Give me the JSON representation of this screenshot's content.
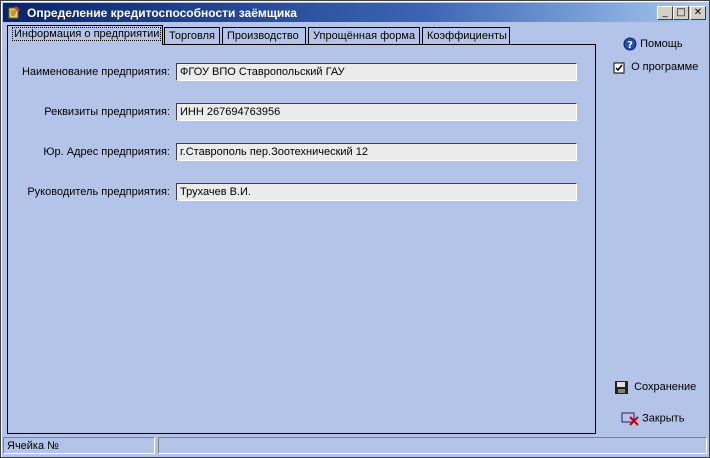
{
  "window": {
    "title": "Определение кредитоспособности заёмщика"
  },
  "titlebar_buttons": {
    "minimize": "_",
    "maximize": "□",
    "close": "✕"
  },
  "tabs": [
    {
      "label": "Информация о предприятии",
      "active": true
    },
    {
      "label": "Торговля",
      "active": false
    },
    {
      "label": "Производство",
      "active": false
    },
    {
      "label": "Упрощённая форма",
      "active": false
    },
    {
      "label": "Коэффициенты",
      "active": false
    }
  ],
  "form": {
    "fields": [
      {
        "label": "Наименование предприятия:",
        "value": "ФГОУ ВПО Ставропольский ГАУ"
      },
      {
        "label": "Реквизиты предприятия:",
        "value": "ИНН 267694763956"
      },
      {
        "label": "Юр. Адрес предприятия:",
        "value": "г.Ставрополь пер.Зоотехнический 12"
      },
      {
        "label": "Руководитель предприятия:",
        "value": "Трухачев В.И."
      }
    ]
  },
  "side": {
    "help": "Помощь",
    "about": "О программе",
    "save": "Сохранение",
    "close": "Закрыть"
  },
  "status": {
    "cell_label": "Ячейка №",
    "cell_value": ""
  }
}
